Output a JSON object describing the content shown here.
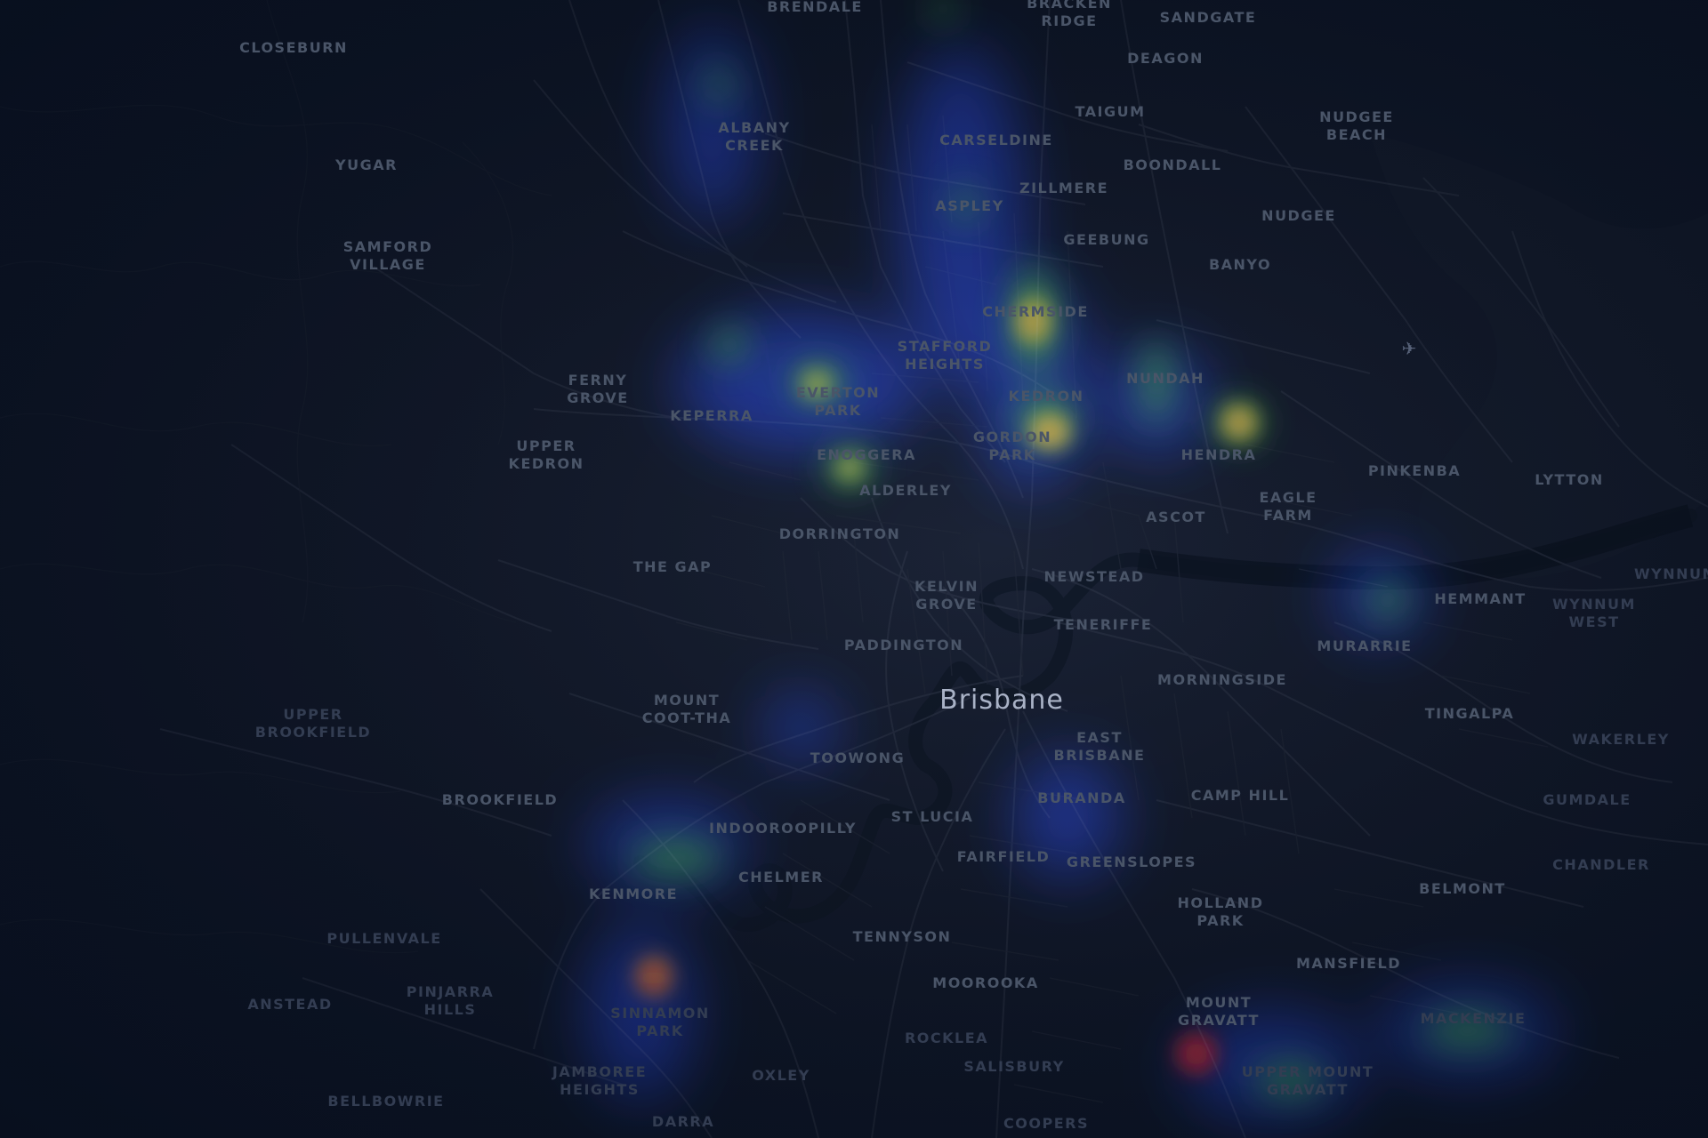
{
  "map": {
    "city": "Brisbane",
    "suburbs": [
      "BRENDALE",
      "BRACKEN\nRIDGE",
      "SANDGATE",
      "CLOSEBURN",
      "DEAGON",
      "TAIGUM",
      "ALBANY\nCREEK",
      "CARSELDINE",
      "NUDGEE\nBEACH",
      "YUGAR",
      "BOONDALL",
      "ZILLMERE",
      "ASPLEY",
      "NUDGEE",
      "SAMFORD\nVILLAGE",
      "GEEBUNG",
      "BANYO",
      "CHERMSIDE",
      "STAFFORD\nHEIGHTS",
      "NUNDAH",
      "FERNY\nGROVE",
      "EVERTON\nPARK",
      "KEDRON",
      "KEPERRA",
      "UPPER\nKEDRON",
      "GORDON\nPARK",
      "HENDRA",
      "ENOGGERA",
      "PINKENBA",
      "LYTTON",
      "ALDERLEY",
      "EAGLE\nFARM",
      "ASCOT",
      "DORRINGTON",
      "THE GAP",
      "NEWSTEAD",
      "WYNNUM",
      "KELVIN\nGROVE",
      "HEMMANT",
      "WYNNUM\nWEST",
      "TENERIFFE",
      "PADDINGTON",
      "MURARRIE",
      "MORNINGSIDE",
      "MOUNT\nCOOT-THA",
      "TINGALPA",
      "UPPER\nBROOKFIELD",
      "EAST\nBRISBANE",
      "WAKERLEY",
      "TOOWONG",
      "BURANDA",
      "CAMP HILL",
      "BROOKFIELD",
      "GUMDALE",
      "INDOOROOPILLY",
      "ST LUCIA",
      "FAIRFIELD",
      "GREENSLOPES",
      "CHANDLER",
      "CHELMER",
      "KENMORE",
      "BELMONT",
      "HOLLAND\nPARK",
      "PULLENVALE",
      "TENNYSON",
      "MANSFIELD",
      "MOOROOKA",
      "ANSTEAD",
      "PINJARRA\nHILLS",
      "SINNAMON\nPARK",
      "MOUNT\nGRAVATT",
      "ROCKLEA",
      "MACKENZIE",
      "JAMBOREE\nHEIGHTS",
      "SALISBURY",
      "UPPER MOUNT\nGRAVATT",
      "OXLEY",
      "BELLBOWRIE",
      "DARRA",
      "COOPERS"
    ],
    "airport_icon": "airplane-icon",
    "heatmap_legend_colors": [
      "#1f3cff",
      "#2f8f2f",
      "#c9c22a",
      "#d47a1c",
      "#c0141c"
    ]
  }
}
